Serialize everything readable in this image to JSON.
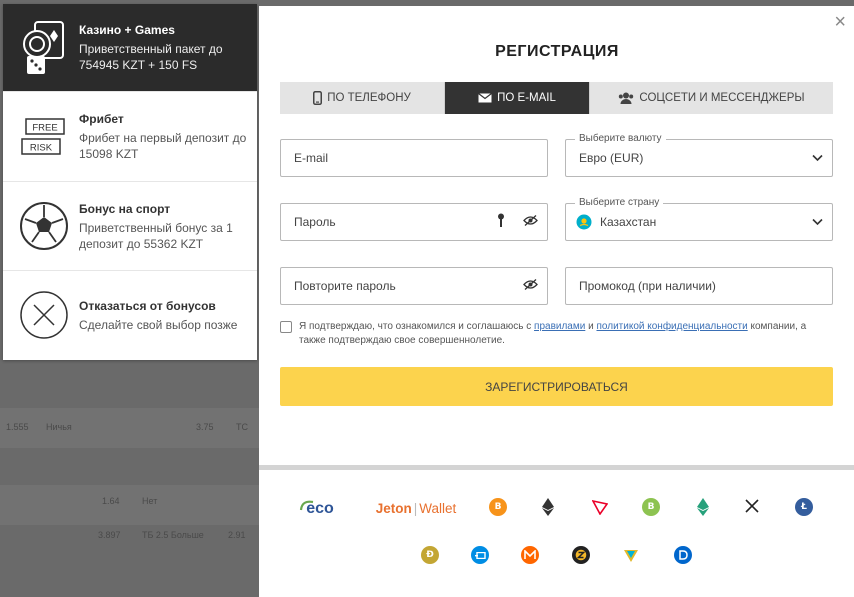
{
  "bonuses": [
    {
      "title": "Казино + Games",
      "desc": "Приветственный пакет до 754945 KZT + 150 FS",
      "icon": "casino-chips-icon"
    },
    {
      "title": "Фрибет",
      "desc": "Фрибет на первый депозит до 15098 KZT",
      "icon": "free-risk-icon",
      "badge_top": "FREE",
      "badge_bottom": "RISK"
    },
    {
      "title": "Бонус на спорт",
      "desc": "Приветственный бонус за 1 депозит до 55362 KZT",
      "icon": "soccer-ball-icon"
    },
    {
      "title": "Отказаться от бонусов",
      "desc": "Сделайте свой выбор позже",
      "icon": "decline-x-icon"
    }
  ],
  "modal": {
    "title": "РЕГИСТРАЦИЯ",
    "close": "×",
    "tabs": [
      {
        "label": "ПО ТЕЛЕФОНУ",
        "icon": "phone-icon",
        "active": false
      },
      {
        "label": "ПО E-MAIL",
        "icon": "envelope-icon",
        "active": true
      },
      {
        "label": "СОЦСЕТИ И МЕССЕНДЖЕРЫ",
        "icon": "users-icon",
        "active": false
      }
    ],
    "email_placeholder": "E-mail",
    "currency_label": "Выберите валюту",
    "currency_value": "Евро (EUR)",
    "password_placeholder": "Пароль",
    "country_label": "Выберите страну",
    "country_value": "Казахстан",
    "repeat_password_placeholder": "Повторите пароль",
    "promo_placeholder": "Промокод (при наличии)",
    "agree_text_1": "Я подтверждаю, что ознакомился и соглашаюсь с",
    "agree_link_1": "правилами",
    "agree_text_2": "и",
    "agree_link_2": "политикой конфиденциальности",
    "agree_text_3": "компании, а также подтверждаю свое совершеннолетие.",
    "register_button": "ЗАРЕГИСТРИРОВАТЬСЯ"
  },
  "payments": {
    "eco": "eco",
    "jeton_a": "Jeton",
    "jeton_b": "Wallet",
    "coins": [
      "B",
      "Ð",
      "Ł"
    ]
  },
  "background": {
    "row1": [
      "1.555",
      "Ничья",
      "3.75",
      "ТС"
    ],
    "row2": [
      "1.64",
      "Нет"
    ],
    "row3": [
      "3.897",
      "ТБ 2.5 Больше",
      "2.91"
    ]
  },
  "colors": {
    "accent_yellow": "#fcd34d",
    "tab_active": "#333333",
    "link_blue": "#3a6fb5",
    "bitcoin": "#f7931a",
    "litecoin": "#345d9d"
  }
}
